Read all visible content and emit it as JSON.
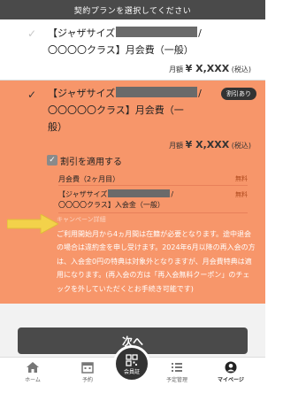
{
  "header": {
    "title": "契約プランを選択してください"
  },
  "plan1": {
    "name_line1": "【ジャザサイズ",
    "name_line2": "〇〇〇〇クラス】月会費（一般）",
    "price_label": "月額",
    "price_value": "¥ X,XXX",
    "price_tax": "(税込)"
  },
  "plan2": {
    "name_line1": "【ジャザサイズ",
    "name_line2": "〇〇〇〇〇クラス】月会費（一",
    "name_line3": "般）",
    "badge": "割引あり",
    "price_label": "月額",
    "price_value": "¥ X,XXX",
    "price_tax": "(税込)",
    "discount_checkbox_label": "割引を適用する",
    "discount_row1_label": "月会費（2ヶ月目）",
    "discount_row1_amount": "無料",
    "discount_row2_line1": "【ジャザサイズ",
    "discount_row2_line2": "〇〇〇〇クラス】入会金（一般）",
    "discount_row2_amount": "無料",
    "notice_title": "キャンペーン詳細",
    "notice_body": "ご利用開始月から4ヵ月間は在籍が必要となります。途中退会の場合は違約金を申し受けます。2024年6月以降の再入会の方は、入会金0円の特典は対象外となりますが、月会費特典は適用になります。(再入会の方は「再入会無料クーポン」のチェックを外していただくとお手続き可能です)"
  },
  "footer": {
    "next_label": "次へ"
  },
  "tabbar": {
    "home": "ホーム",
    "reserve": "予約",
    "member_card": "会員証",
    "schedule": "予定管理",
    "mypage": "マイページ"
  },
  "colors": {
    "accent": "#f7966a",
    "dark": "#4a4a4a",
    "arrow": "#f3d24a"
  },
  "icons": [
    "check-icon",
    "home-icon",
    "calendar-icon",
    "qr-icon",
    "list-icon",
    "user-icon",
    "arrow-right-icon"
  ]
}
